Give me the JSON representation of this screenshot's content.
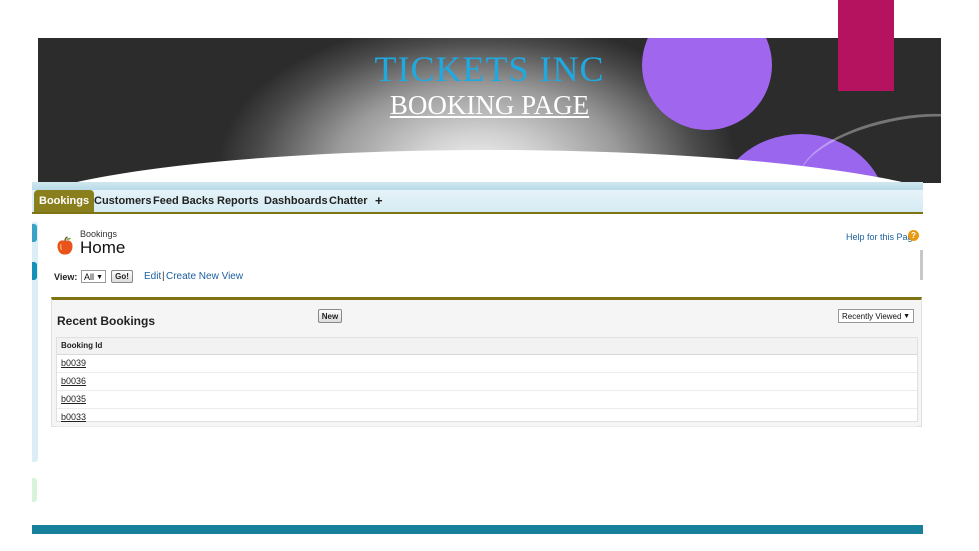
{
  "banner": {
    "title": "TICKETS INC",
    "subtitle": "BOOKING PAGE"
  },
  "tabs": [
    {
      "label": "Bookings",
      "active": true
    },
    {
      "label": "Customers"
    },
    {
      "label": "Feed Backs"
    },
    {
      "label": "Reports"
    },
    {
      "label": "Dashboards"
    },
    {
      "label": "Chatter"
    },
    {
      "label": "+"
    }
  ],
  "page": {
    "breadcrumb": "Bookings",
    "title": "Home",
    "help_link": "Help for this Page",
    "help_icon": "?"
  },
  "view_bar": {
    "label": "View:",
    "selected": "All",
    "go_label": "Go!",
    "edit_label": "Edit",
    "separator": "|",
    "create_label": "Create New View"
  },
  "recent": {
    "title": "Recent Bookings",
    "new_label": "New",
    "filter_selected": "Recently Viewed",
    "column_header": "Booking Id",
    "rows": [
      "b0039",
      "b0036",
      "b0035",
      "b0033"
    ]
  },
  "colors": {
    "banner_title": "#1fa9e1",
    "accent_block": "#b5135f",
    "circles": "#a066ee",
    "tab_active": "#8a7f1d",
    "link": "#1b5f9e",
    "footer_bar": "#17819b"
  }
}
